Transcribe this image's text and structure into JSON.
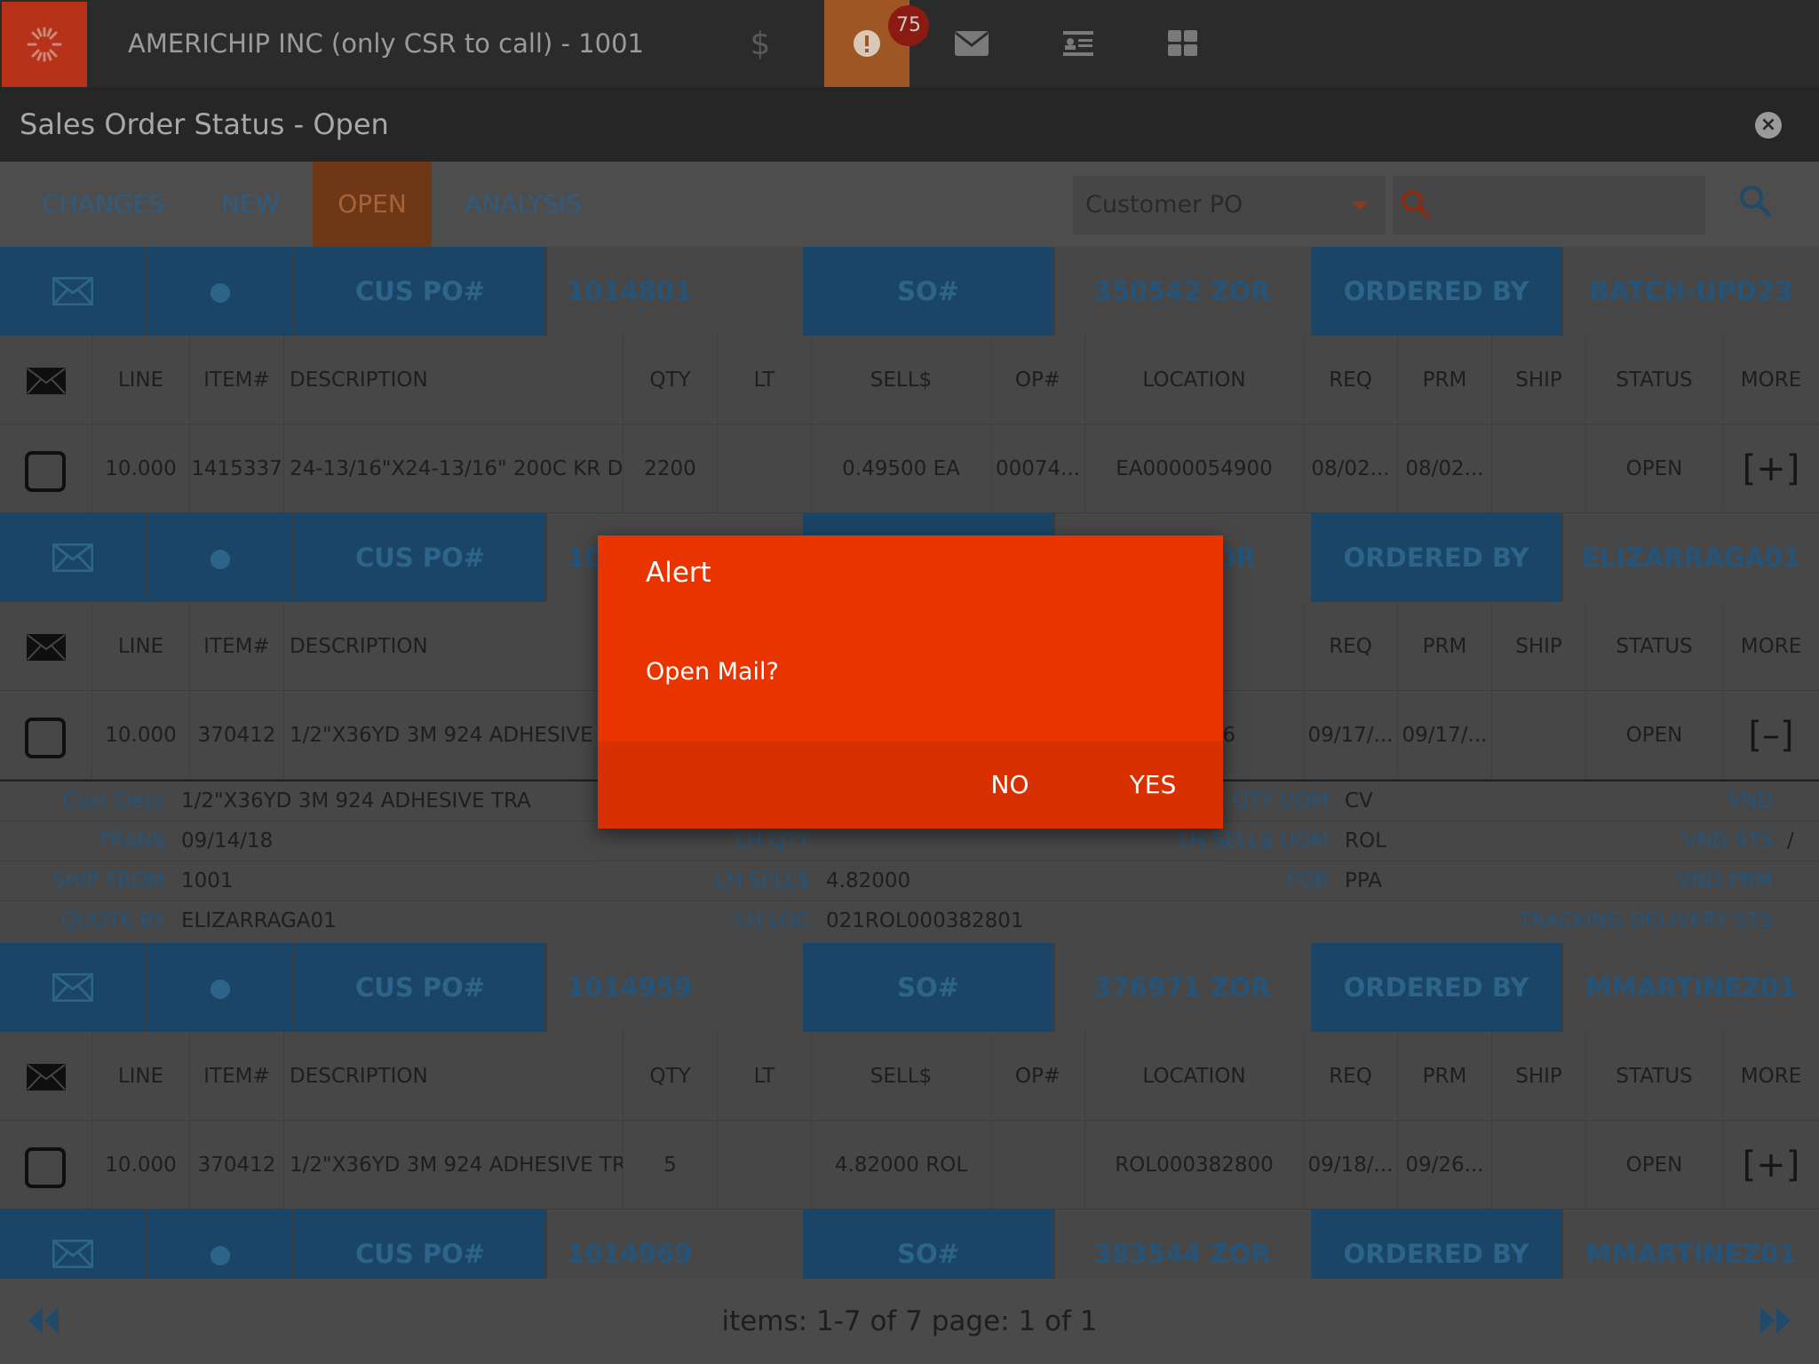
{
  "app": {
    "company": "AMERICHIP INC (only CSR to call) - 1001",
    "alert_count": "75",
    "page_title": "Sales Order Status - Open"
  },
  "tabs": [
    {
      "label": "CHANGES"
    },
    {
      "label": "NEW"
    },
    {
      "label": "OPEN",
      "active": true
    },
    {
      "label": "ANALYSIS"
    }
  ],
  "search": {
    "field_selected": "Customer PO",
    "query": ""
  },
  "column_headers": [
    "LINE",
    "ITEM#",
    "DESCRIPTION",
    "QTY",
    "LT",
    "SELL$",
    "OP#",
    "LOCATION",
    "REQ",
    "PRM",
    "SHIP",
    "STATUS",
    "MORE"
  ],
  "order_labels": {
    "cus_po": "CUS PO#",
    "so": "SO#",
    "ordered_by": "ORDERED BY"
  },
  "orders": [
    {
      "cus_po": "1014801",
      "so": "350542 ZOR",
      "ordered_by": "BATCH-UPD23",
      "line": {
        "line": "10.000",
        "item": "1415337",
        "description": "24-13/16\"X24-13/16\" 200C KR D/...",
        "qty": "2200",
        "lt": "",
        "sell": "0.49500 EA",
        "op": "00074...",
        "location": "EA0000054900",
        "req": "08/02...",
        "prm": "08/02...",
        "ship": "",
        "status": "OPEN",
        "more": "[+]"
      }
    },
    {
      "cus_po": "10",
      "so": "",
      "so_tail": "OR",
      "ordered_by": "ELIZARRAGA01",
      "line": {
        "line": "10.000",
        "item": "370412",
        "description": "1/2\"X36YD 3M 924 ADHESIVE TRA",
        "qty": "",
        "lt": "",
        "sell": "",
        "op": "",
        "location": "2806",
        "location_header": "N",
        "req": "09/17/...",
        "prm": "09/17/...",
        "ship": "",
        "status": "OPEN",
        "more": "[–]"
      },
      "details": {
        "cust_desc_label": "Cust Desc",
        "cust_desc": "1/2\"X36YD 3M 924 ADHESIVE TRA",
        "trans_label": "TRANS",
        "trans": "09/14/18",
        "ship_from_label": "SHIP FROM",
        "ship_from": "1001",
        "quote_by_label": "QUOTE BY",
        "quote_by": "ELIZARRAGA01",
        "lh_qty_uom_label": "H QTY UOM",
        "lh_qty_uom": "CV",
        "lh_qty_label": "LH QTY",
        "lh_qty": "",
        "lh_sell_uom_label": "LH SELL$ UOM",
        "lh_sell_uom": "ROL",
        "lh_sell_label": "LH SELL$",
        "lh_sell": "4.82000",
        "fob_label": "FOB",
        "fob": "PPA",
        "lh_loc_label": "LH LOC",
        "lh_loc": "021ROL000382801",
        "vnd_label": "VND",
        "vnd_sts_label": "VND STS",
        "vnd_sts": "/",
        "vnd_prm_label": "VND PRM",
        "tracking_label": "TRACKING DELIVERY STS"
      }
    },
    {
      "cus_po": "1014959",
      "so": "376971 ZOR",
      "ordered_by": "MMARTINEZ01",
      "line": {
        "line": "10.000",
        "item": "370412",
        "description": "1/2\"X36YD 3M 924 ADHESIVE TRA",
        "qty": "5",
        "lt": "",
        "sell": "4.82000 ROL",
        "op": "",
        "location": "ROL000382800",
        "req": "09/18/...",
        "prm": "09/26...",
        "ship": "",
        "status": "OPEN",
        "more": "[+]"
      }
    },
    {
      "cus_po": "1014969",
      "so": "383544 ZOR",
      "ordered_by": "MMARTINEZ01"
    }
  ],
  "pager": {
    "text": "items: 1-7 of 7   page: 1 of 1"
  },
  "dialog": {
    "title": "Alert",
    "message": "Open Mail?",
    "no_label": "NO",
    "yes_label": "YES"
  },
  "colors": {
    "accent_orange": "#ea3400",
    "header_blue": "#1a4566",
    "link_blue": "#24547a"
  }
}
